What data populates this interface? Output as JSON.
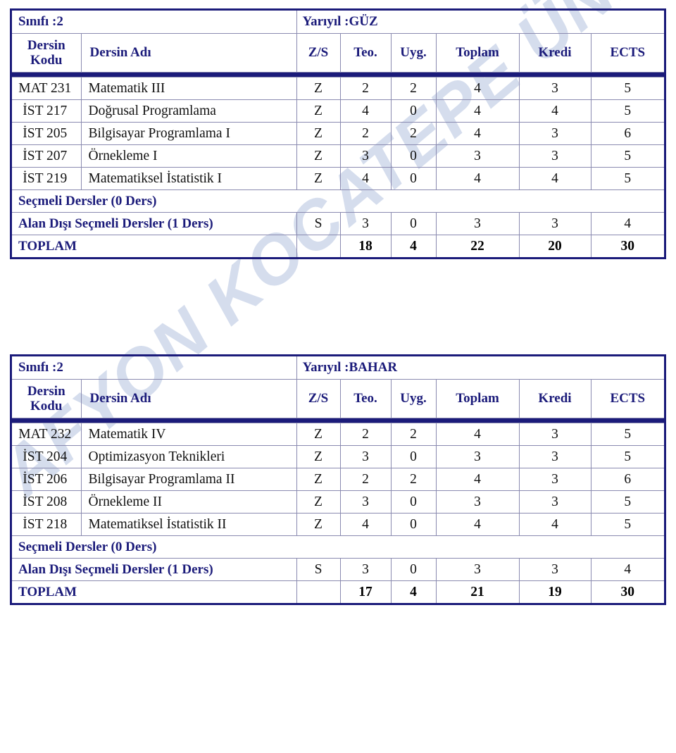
{
  "watermark": {
    "text": "AFYON KOCATEPE ÜNİVERSİTESİ"
  },
  "columns": {
    "kodu": "Dersin\nKodu",
    "kodu_line1": "Dersin",
    "kodu_line2": "Kodu",
    "adi": "Dersin Adı",
    "zs": "Z/S",
    "teo": "Teo.",
    "uyg": "Uyg.",
    "toplam": "Toplam",
    "kredi": "Kredi",
    "ects": "ECTS"
  },
  "tables": [
    {
      "id": "guz",
      "sinif_label": "Sınıfı :2",
      "yariyil_label": "Yarıyıl :GÜZ",
      "rows": [
        {
          "kodu": "MAT 231",
          "adi": "Matematik III",
          "zs": "Z",
          "teo": "2",
          "uyg": "2",
          "toplam": "4",
          "kredi": "3",
          "ects": "5"
        },
        {
          "kodu": "İST 217",
          "adi": "Doğrusal Programlama",
          "zs": "Z",
          "teo": "4",
          "uyg": "0",
          "toplam": "4",
          "kredi": "4",
          "ects": "5"
        },
        {
          "kodu": "İST 205",
          "adi": "Bilgisayar Programlama I",
          "zs": "Z",
          "teo": "2",
          "uyg": "2",
          "toplam": "4",
          "kredi": "3",
          "ects": "6"
        },
        {
          "kodu": "İST 207",
          "adi": "Örnekleme I",
          "zs": "Z",
          "teo": "3",
          "uyg": "0",
          "toplam": "3",
          "kredi": "3",
          "ects": "5"
        },
        {
          "kodu": "İST 219",
          "adi": "Matematiksel İstatistik I",
          "zs": "Z",
          "teo": "4",
          "uyg": "0",
          "toplam": "4",
          "kredi": "4",
          "ects": "5"
        }
      ],
      "secmeli": {
        "label": "Seçmeli Dersler  (0 Ders)"
      },
      "alan_disi": {
        "label": "Alan Dışı Seçmeli Dersler (1 Ders)",
        "zs": "S",
        "teo": "3",
        "uyg": "0",
        "toplam": "3",
        "kredi": "3",
        "ects": "4"
      },
      "toplam_row": {
        "label": "TOPLAM",
        "zs": "",
        "teo": "18",
        "uyg": "4",
        "toplam": "22",
        "kredi": "20",
        "ects": "30"
      }
    },
    {
      "id": "bahar",
      "sinif_label": "Sınıfı :2",
      "yariyil_label": "Yarıyıl :BAHAR",
      "rows": [
        {
          "kodu": "MAT 232",
          "adi": "Matematik IV",
          "zs": "Z",
          "teo": "2",
          "uyg": "2",
          "toplam": "4",
          "kredi": "3",
          "ects": "5"
        },
        {
          "kodu": "İST 204",
          "adi": "Optimizasyon Teknikleri",
          "zs": "Z",
          "teo": "3",
          "uyg": "0",
          "toplam": "3",
          "kredi": "3",
          "ects": "5"
        },
        {
          "kodu": "İST 206",
          "adi": "Bilgisayar Programlama II",
          "zs": "Z",
          "teo": "2",
          "uyg": "2",
          "toplam": "4",
          "kredi": "3",
          "ects": "6"
        },
        {
          "kodu": "İST 208",
          "adi": "Örnekleme II",
          "zs": "Z",
          "teo": "3",
          "uyg": "0",
          "toplam": "3",
          "kredi": "3",
          "ects": "5"
        },
        {
          "kodu": "İST 218",
          "adi": "Matematiksel İstatistik II",
          "zs": "Z",
          "teo": "4",
          "uyg": "0",
          "toplam": "4",
          "kredi": "4",
          "ects": "5"
        }
      ],
      "secmeli": {
        "label": "Seçmeli Dersler  (0 Ders)"
      },
      "alan_disi": {
        "label": "Alan Dışı Seçmeli Dersler (1 Ders)",
        "zs": "S",
        "teo": "3",
        "uyg": "0",
        "toplam": "3",
        "kredi": "3",
        "ects": "4"
      },
      "toplam_row": {
        "label": "TOPLAM",
        "zs": "",
        "teo": "17",
        "uyg": "4",
        "toplam": "21",
        "kredi": "19",
        "ects": "30"
      }
    }
  ],
  "colors": {
    "heading_blue": "#1b1b7a",
    "border_blue": "#1b1b7a",
    "grid_gray": "#8a8ab0",
    "watermark_blue": "#ccd6ea",
    "body_text": "#111111"
  }
}
